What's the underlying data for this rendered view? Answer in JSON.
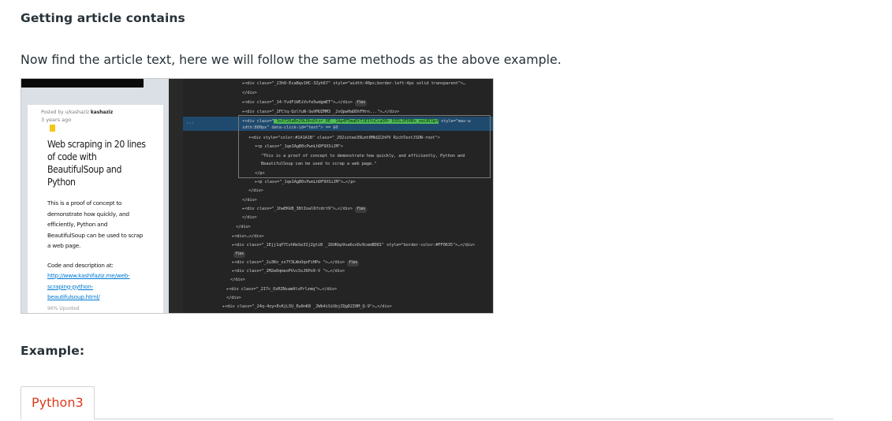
{
  "heading1": "Getting article contains",
  "intro": "Now find the article text, here we will follow the same methods as the above example.",
  "heading2": "Example:",
  "tab": {
    "label": "Python3"
  },
  "screenshot": {
    "reddit": {
      "posted_prefix": "Posted by u/kashaziz",
      "username_badge": "kashaziz",
      "age": "3 years ago",
      "title": "Web scraping in 20 lines of code with BeautifulSoup and Python",
      "body": "This is a proof of concept to demonstrate how quickly, and efficiently, Python and BeautifulSoup can be used to scrap a web page.",
      "code_label": "Code and description at:",
      "link": "http://www.kashifaziz.me/web-scraping-python-beautifulsoup.html/",
      "upvoted": "96% Upvoted"
    },
    "devtools_lines": [
      "▸<div class=\"_23h0-EcaBqv1HC-3Zyh67\" style=\"width:40px;border-left:4px solid transparent\">…",
      "</div>",
      "▸<div class=\"_14-YvdFiW5iVvfe5wdgmET\">…</div>",
      "▸<div class=\"_2FCtq-QzlfuN-SwVMUZMM3 _2vQpwHaDDhFHrn...\">…</div>",
      "▾<div class=\"",
      "_292iotee39Lmt0MkQZ2hPV RichTextJSON-root",
      "idth:800px\" data-click-id=\"text\"> == $0",
      "▾<div style=\"color:#1A1A1B\" class=\"_292iotee39Lmt0MkQZ2hPV RichTextJSON-root\">",
      "▾<p class=\"_1qeIAgB0cPwnLhDF9XSiJM\">",
      "\"This is a proof of concept to demonstrate how quickly, and efficiently, Python and",
      "BeautifulSoup can be used to scrap a web page.\"",
      "</p>",
      "▸<p class=\"_1qeIAgB0cPwnLhDF9XSiJM\">…</p>",
      "</div>",
      "</div>",
      "▸<div class=\"_1hwEKkB_38tIoal6fcdrt9\">…</div>",
      "</div>",
      "</div>",
      "▸<div>…</div>",
      "▸<div class=\"_1Ejj1qP7CvhReSe3IjZgtiB _1DUKbp9va6vxDv9cemBD81\" style=\"border-color:#FF0635\">…</div>",
      "▸<div class=\"_2u3Kn_zs7Y3LWoOqoFiHPo \">…</div>",
      "▸<div class=\"_2M2wOqmeoPVvcSsJ6Po9-V \">…</div>",
      "</div>",
      "▸<div class=\"_2I7c_OzRINsamAlvPrlzmq\">…</div>",
      "</div>",
      "▸<div class=\"_24q-4oy+EvKjL5U_Ew9nK8 _2Wb4iSiUbjZQgD2I8M_Q-9\">…</div>"
    ],
    "selected_class": "_3xX726aBn29LDbsDtzr_6E _1Ap4F5maDtT1E1YuCiaO0r D3IL3FD0Rx_eeLBCUpf",
    "selected_style": "style=\"max-w",
    "flex_badge": "flex",
    "ellipsis": "···"
  }
}
